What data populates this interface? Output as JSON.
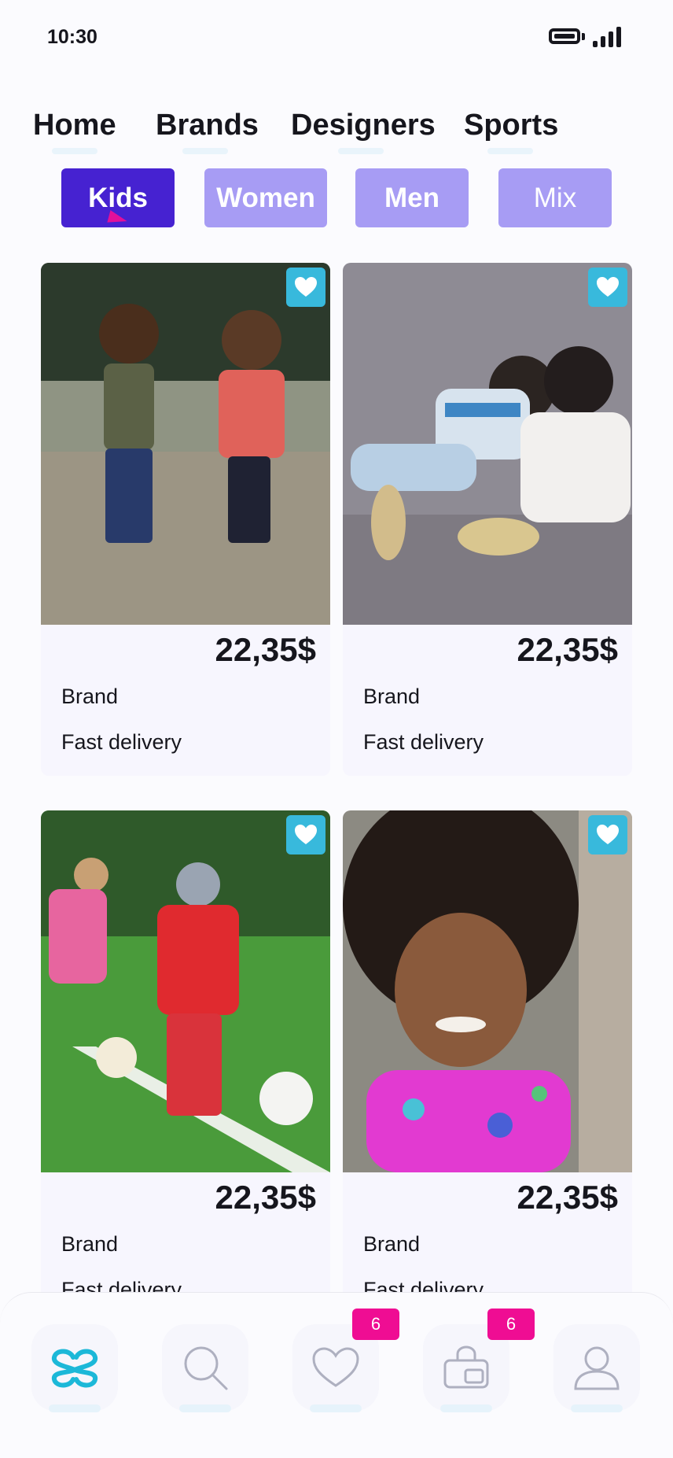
{
  "status_bar": {
    "time": "10:30"
  },
  "nav": {
    "items": [
      {
        "label": "Home"
      },
      {
        "label": "Brands"
      },
      {
        "label": "Designers"
      },
      {
        "label": "Sports"
      }
    ]
  },
  "filters": {
    "selected": "Kids",
    "options": [
      {
        "label": "Kids"
      },
      {
        "label": "Women"
      },
      {
        "label": "Men"
      },
      {
        "label": "Mix"
      }
    ]
  },
  "products": [
    {
      "price": "22,35$",
      "brand": "Brand",
      "delivery": "Fast delivery",
      "favorite_icon": "heart-icon"
    },
    {
      "price": "22,35$",
      "brand": "Brand",
      "delivery": "Fast delivery",
      "favorite_icon": "heart-icon"
    },
    {
      "price": "22,35$",
      "brand": "Brand",
      "delivery": "Fast delivery",
      "favorite_icon": "heart-icon"
    },
    {
      "price": "22,35$",
      "brand": "Brand",
      "delivery": "Fast delivery",
      "favorite_icon": "heart-icon"
    }
  ],
  "bottom_nav": {
    "tabs": [
      {
        "icon": "logo-icon"
      },
      {
        "icon": "search-icon"
      },
      {
        "icon": "heart-icon",
        "badge": "6"
      },
      {
        "icon": "bag-icon",
        "badge": "6"
      },
      {
        "icon": "profile-icon"
      }
    ]
  },
  "colors": {
    "accent": "#4622d1",
    "chip_unselected": "#a79cf4",
    "favorite": "#38b9dc",
    "badge": "#ef0d93",
    "logo": "#1cb8d8"
  }
}
